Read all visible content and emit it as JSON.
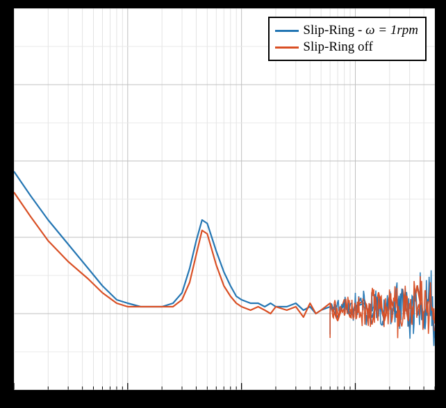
{
  "chart_data": {
    "type": "line",
    "title": "",
    "xlabel": "",
    "ylabel": "",
    "xscale": "log",
    "xlim": [
      0.1,
      500
    ],
    "ylim": [
      -0.05,
      1.05
    ],
    "grid": true,
    "legend_position": "top-right",
    "series": [
      {
        "name": "Slip-Ring - ω = 1rpm",
        "color": "#2476b3",
        "x": [
          0.1,
          0.14,
          0.2,
          0.3,
          0.45,
          0.6,
          0.8,
          1.0,
          1.3,
          1.7,
          2.0,
          2.5,
          3.0,
          3.5,
          4.0,
          4.5,
          5.0,
          6.0,
          7.0,
          8.0,
          9.0,
          10,
          12,
          14,
          16,
          18,
          20,
          25,
          30,
          35,
          40,
          45,
          50,
          60,
          70,
          80,
          90,
          100,
          120,
          140,
          160,
          180,
          200,
          230,
          260,
          300,
          350,
          400,
          450,
          500
        ],
        "y": [
          0.58,
          0.51,
          0.44,
          0.37,
          0.3,
          0.25,
          0.21,
          0.2,
          0.19,
          0.19,
          0.19,
          0.2,
          0.23,
          0.3,
          0.38,
          0.44,
          0.43,
          0.35,
          0.29,
          0.25,
          0.22,
          0.21,
          0.2,
          0.2,
          0.19,
          0.2,
          0.19,
          0.19,
          0.2,
          0.18,
          0.19,
          0.17,
          0.18,
          0.19,
          0.16,
          0.2,
          0.17,
          0.19,
          0.2,
          0.16,
          0.21,
          0.15,
          0.22,
          0.17,
          0.23,
          0.14,
          0.25,
          0.16,
          0.22,
          0.11
        ]
      },
      {
        "name": "Slip-Ring off",
        "color": "#d94f24",
        "x": [
          0.1,
          0.14,
          0.2,
          0.3,
          0.45,
          0.6,
          0.8,
          1.0,
          1.3,
          1.7,
          2.0,
          2.5,
          3.0,
          3.5,
          4.0,
          4.5,
          5.0,
          6.0,
          7.0,
          8.0,
          9.0,
          10,
          12,
          14,
          16,
          18,
          20,
          25,
          30,
          35,
          40,
          45,
          50,
          60,
          70,
          80,
          90,
          100,
          120,
          140,
          160,
          180,
          200,
          230,
          260,
          300,
          350,
          400,
          450,
          500
        ],
        "y": [
          0.52,
          0.45,
          0.38,
          0.32,
          0.27,
          0.23,
          0.2,
          0.19,
          0.19,
          0.19,
          0.19,
          0.19,
          0.21,
          0.26,
          0.34,
          0.41,
          0.4,
          0.31,
          0.25,
          0.22,
          0.2,
          0.19,
          0.18,
          0.19,
          0.18,
          0.17,
          0.19,
          0.18,
          0.19,
          0.16,
          0.2,
          0.17,
          0.18,
          0.2,
          0.15,
          0.21,
          0.16,
          0.19,
          0.21,
          0.14,
          0.23,
          0.15,
          0.22,
          0.16,
          0.24,
          0.13,
          0.25,
          0.14,
          0.23,
          0.1
        ]
      }
    ]
  },
  "legend": {
    "items": [
      {
        "label_prefix": "Slip-Ring - ",
        "label_var": "ω = 1",
        "label_unit": "rpm"
      },
      {
        "label": "Slip-Ring off"
      }
    ]
  }
}
